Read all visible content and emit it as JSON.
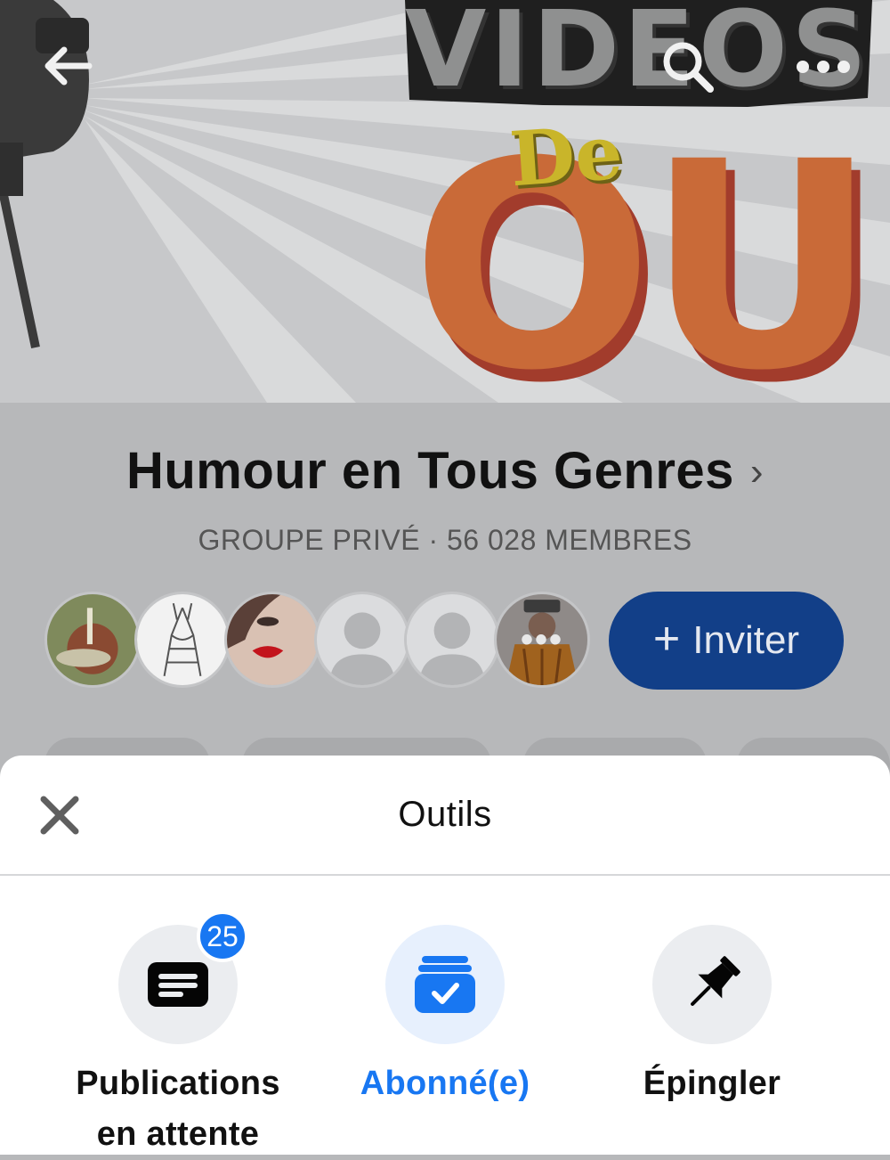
{
  "cover": {
    "wordmark_top": "VIDEOS",
    "wordmark_de": "De",
    "wordmark_main": "OUF"
  },
  "header_icons": [
    "back-arrow-icon",
    "search-icon",
    "more-options-icon"
  ],
  "group": {
    "name": "Humour en Tous Genres",
    "chevron": "›",
    "meta": "GROUPE PRIVÉ · 56 028 MEMBRES",
    "member_avatars": [
      "warrior-figure",
      "knight-sketch",
      "woman-red-lips",
      "default-person",
      "default-person",
      "man-hat"
    ],
    "more_members": "•••",
    "invite": {
      "plus": "+",
      "label": "Inviter"
    }
  },
  "colors": {
    "invite_bg": "#123f88",
    "accent": "#1877f2",
    "badge": "#1877f2",
    "overlay": "#b7b8ba"
  },
  "sheet": {
    "title": "Outils",
    "close_icon": "close-icon",
    "tools": [
      {
        "icon": "pending-posts-icon",
        "badge": "25",
        "line1": "Publications",
        "line2": "en attente",
        "active": false
      },
      {
        "icon": "subscribed-check-icon",
        "line1": "Abonné(e)",
        "active": true
      },
      {
        "icon": "pin-icon",
        "line1": "Épingler",
        "active": false
      }
    ]
  }
}
